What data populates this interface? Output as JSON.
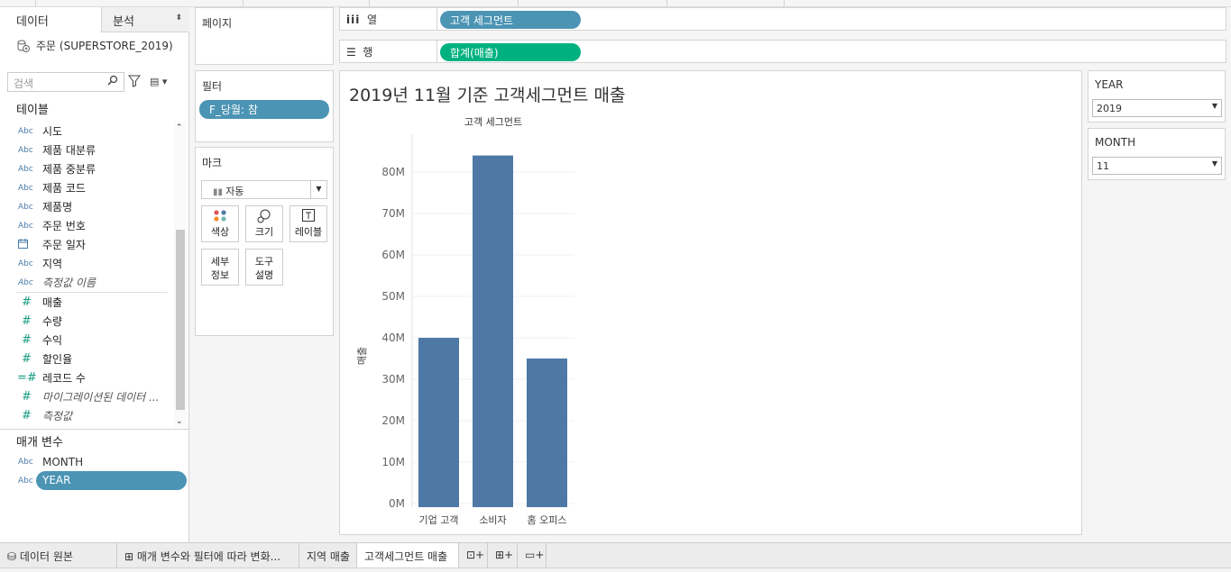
{
  "left_panel": {
    "tab_data": "데이터",
    "tab_analysis": "분석",
    "datasource": "주문 (SUPERSTORE_2019)",
    "search_placeholder": "검색",
    "tables_header": "테이블",
    "dimensions": [
      {
        "type": "Abc",
        "name": "시도"
      },
      {
        "type": "Abc",
        "name": "제품 대분류"
      },
      {
        "type": "Abc",
        "name": "제품 중분류"
      },
      {
        "type": "Abc",
        "name": "제품 코드"
      },
      {
        "type": "Abc",
        "name": "제품명"
      },
      {
        "type": "Abc",
        "name": "주문 번호"
      },
      {
        "type": "date",
        "name": "주문 일자"
      },
      {
        "type": "Abc",
        "name": "지역"
      },
      {
        "type": "Abc",
        "name": "측정값 이름"
      }
    ],
    "measures": [
      {
        "type": "#",
        "name": "매출"
      },
      {
        "type": "#",
        "name": "수량"
      },
      {
        "type": "#",
        "name": "수익"
      },
      {
        "type": "#",
        "name": "할인율"
      },
      {
        "type": "=#",
        "name": "레코드 수"
      },
      {
        "type": "#",
        "name": "마이그레이션된 데이터 ..."
      },
      {
        "type": "#",
        "name": "측정값"
      }
    ],
    "params_header": "매개 변수",
    "parameters": [
      {
        "type": "Abc",
        "name": "MONTH"
      },
      {
        "type": "Abc",
        "name": "YEAR"
      }
    ]
  },
  "pages_label": "페이지",
  "filters": {
    "label": "필터",
    "pill": "F_당월: 참"
  },
  "marks": {
    "label": "마크",
    "type": "자동",
    "buttons": [
      "색상",
      "크기",
      "레이블",
      "세부\n정보",
      "도구\n설명"
    ]
  },
  "shelves": {
    "columns_label": "열",
    "columns_pill": "고객 세그먼트",
    "rows_label": "행",
    "rows_pill": "합계(매출)"
  },
  "view_title": "2019년 11월 기준 고객세그먼트 매출",
  "chart_data": {
    "type": "bar",
    "title": "고객 세그먼트",
    "ylabel": "매출",
    "categories": [
      "기업 고객",
      "소비자",
      "홈 오피스"
    ],
    "values": [
      40,
      84,
      35
    ],
    "unit": "M",
    "ylim": [
      0,
      88
    ],
    "yticks": [
      "0M",
      "10M",
      "20M",
      "30M",
      "40M",
      "50M",
      "60M",
      "70M",
      "80M"
    ],
    "bar_color": "#4e79a7",
    "grid": true
  },
  "right_panel": {
    "year_label": "YEAR",
    "year_value": "2019",
    "month_label": "MONTH",
    "month_value": "11"
  },
  "bottom_tabs": [
    "데이터 원본",
    "매개 변수와 필터에 따라 변화...",
    "지역 매출",
    "고객세그먼트 매출"
  ],
  "colors": {
    "dimension_pill": "#4c94b4",
    "measure_pill": "#00b180",
    "bar": "#4e79a7"
  }
}
